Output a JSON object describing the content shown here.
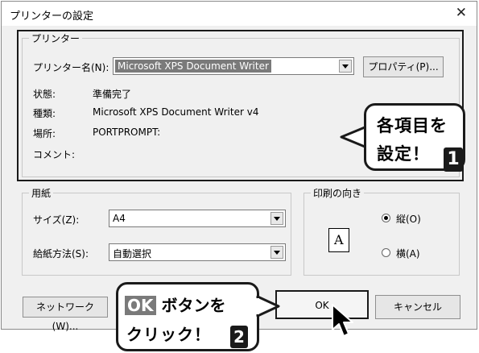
{
  "window": {
    "title": "プリンターの設定"
  },
  "printer": {
    "group_label": "プリンター",
    "name_label": "プリンター名(N):",
    "name_value": "Microsoft XPS Document Writer",
    "properties_button": "プロパティ(P)...",
    "status_label": "状態:",
    "status_value": "準備完了",
    "type_label": "種類:",
    "type_value": "Microsoft XPS Document Writer v4",
    "location_label": "場所:",
    "location_value": "PORTPROMPT:",
    "comment_label": "コメント:"
  },
  "paper": {
    "group_label": "用紙",
    "size_label": "サイズ(Z):",
    "size_value": "A4",
    "source_label": "給紙方法(S):",
    "source_value": "自動選択"
  },
  "orientation": {
    "group_label": "印刷の向き",
    "preview_letter": "A",
    "portrait_label": "縦(O)",
    "landscape_label": "横(A)"
  },
  "buttons": {
    "network": "ネットワーク(W)...",
    "ok": "OK",
    "cancel": "キャンセル"
  },
  "callouts": {
    "settings_line1": "各項目を",
    "settings_line2": "設定！",
    "settings_badge": "1",
    "ok_highlight": "OK",
    "ok_line1_rest": "ボタンを",
    "ok_line2": "クリック！",
    "ok_badge": "2"
  },
  "colors": {
    "highlight_bg": "#7a7a7a",
    "outline": "#1a1a1a",
    "dialog_bg": "#f0f0f0"
  }
}
